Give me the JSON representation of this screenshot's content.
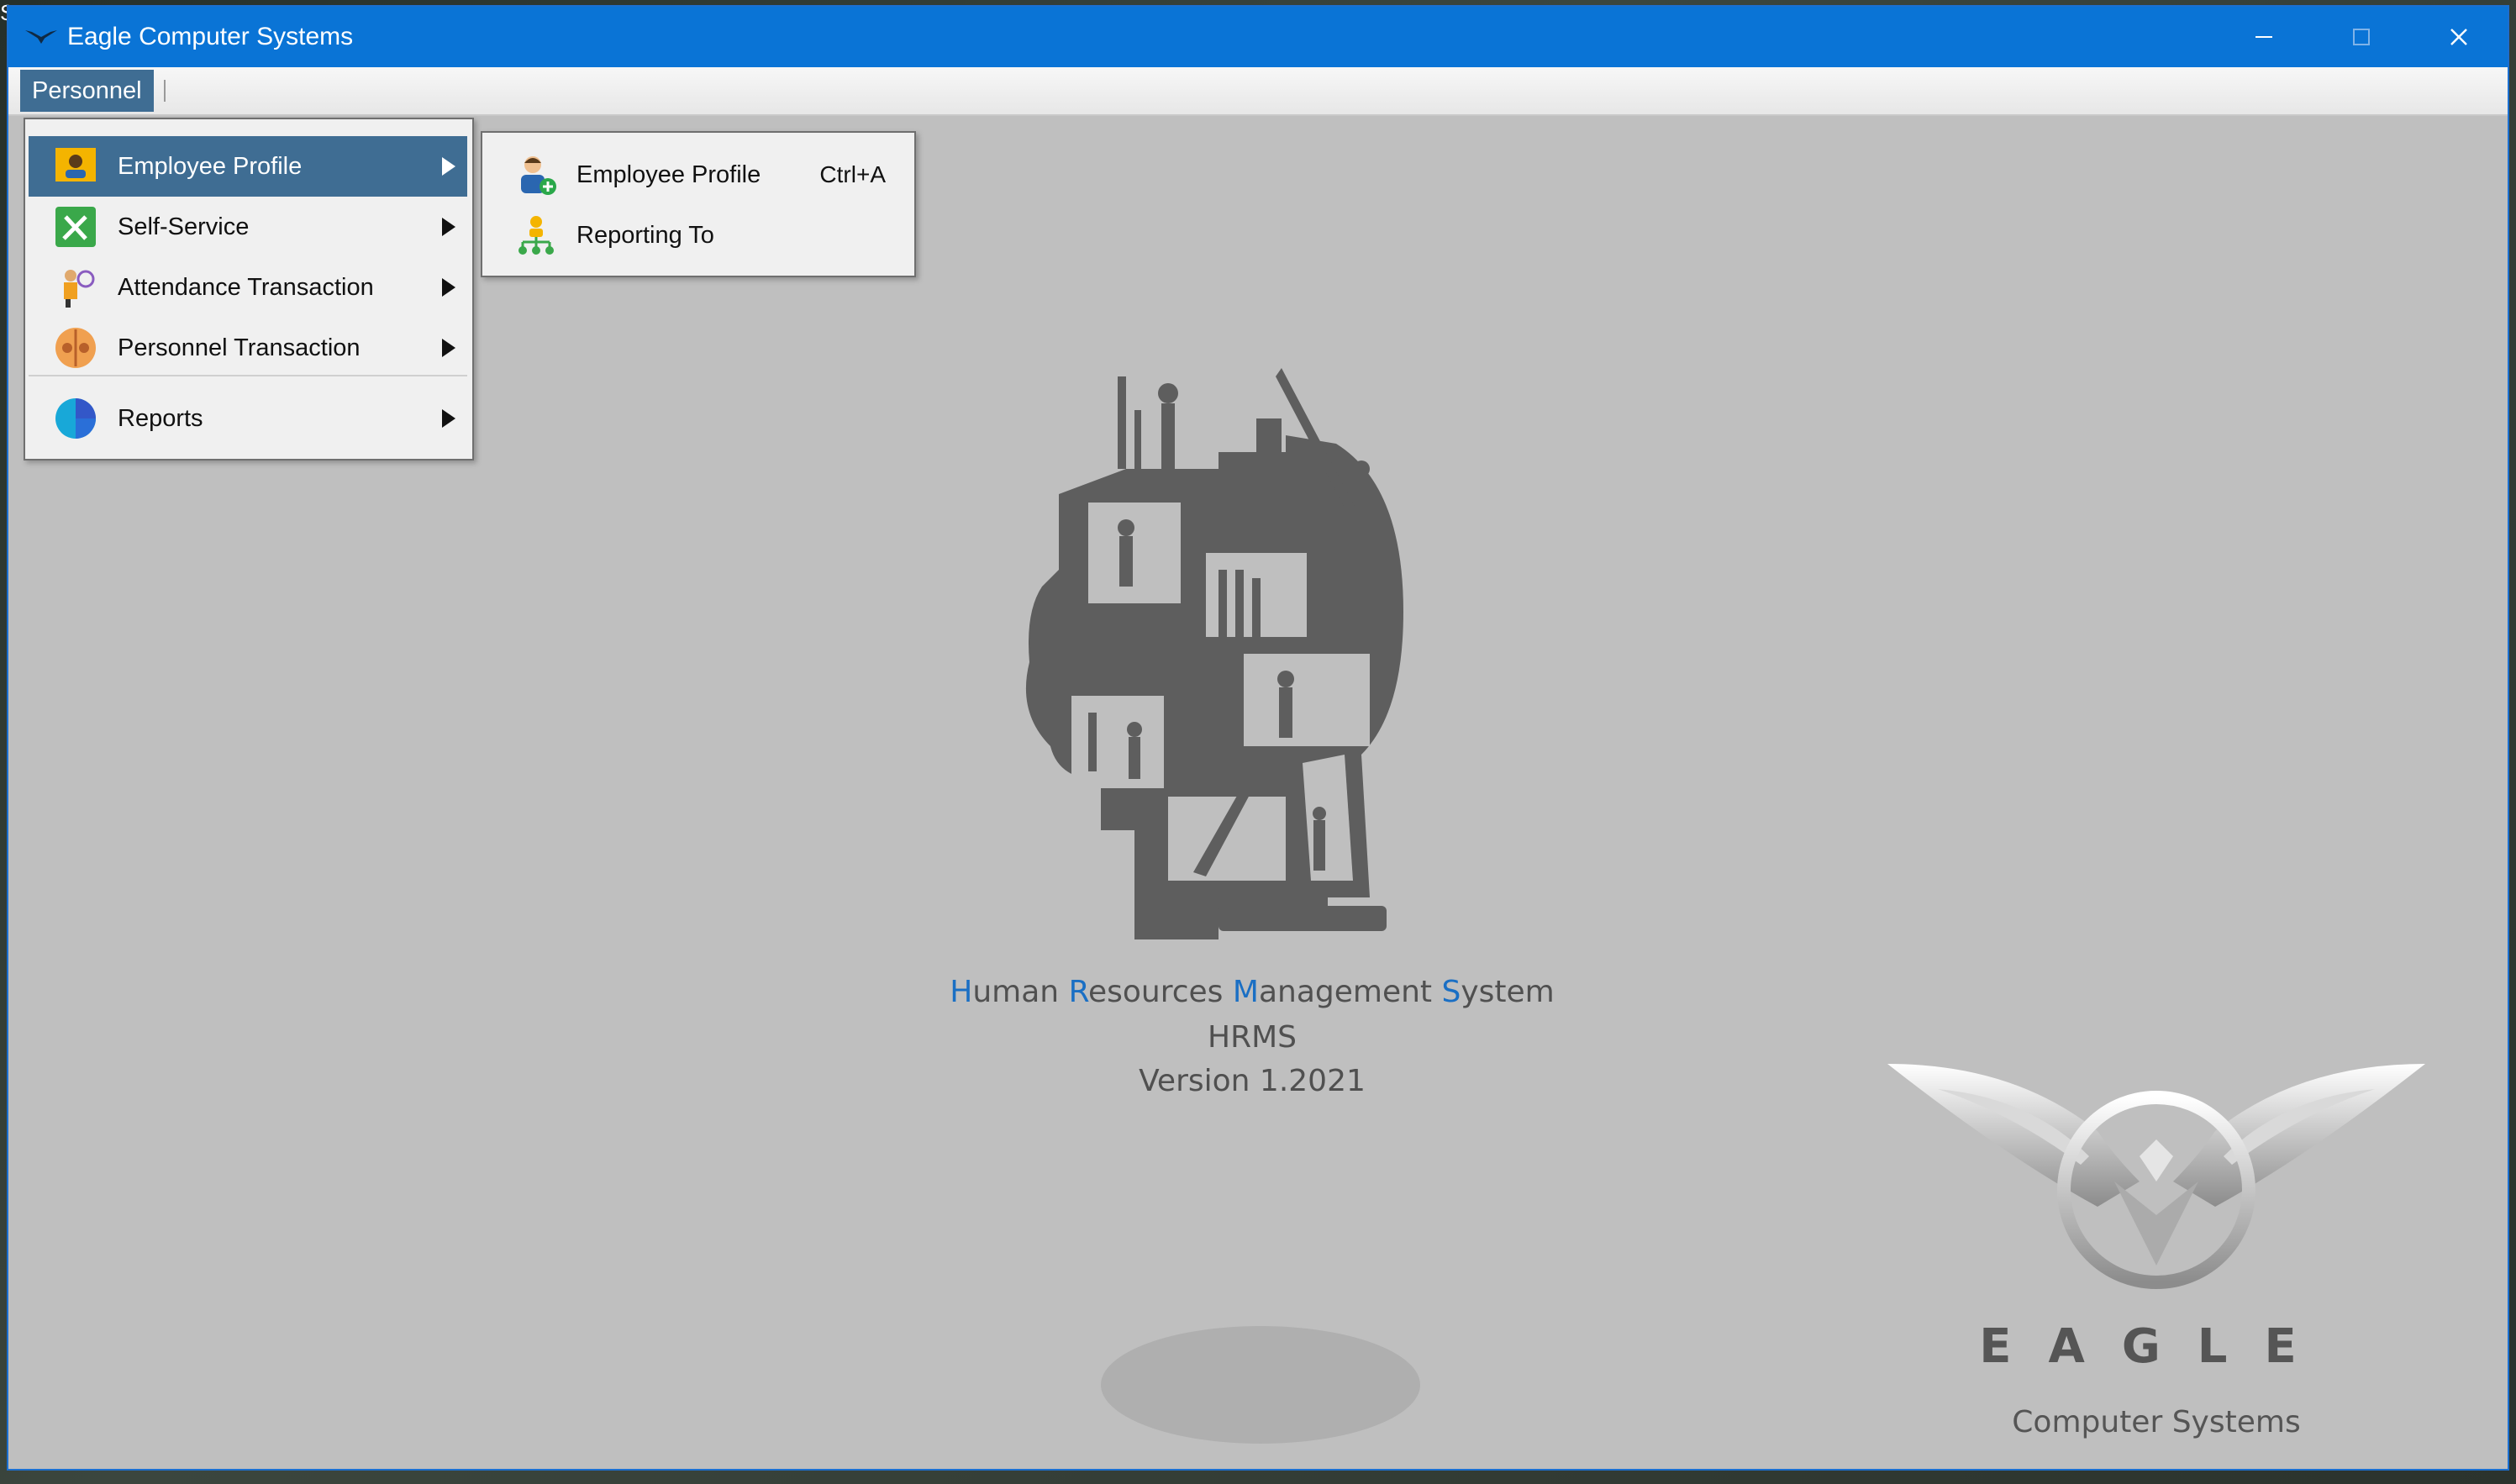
{
  "window": {
    "title": "Eagle Computer Systems",
    "controls": [
      "minimize",
      "maximize",
      "close"
    ]
  },
  "desktop": {
    "clipped_text": "S"
  },
  "menubar": {
    "personnel_label": "Personnel"
  },
  "dropdown": {
    "items": [
      {
        "label": "Employee Profile",
        "icon": "employee-profile-icon",
        "active": true
      },
      {
        "label": "Self-Service",
        "icon": "self-service-icon"
      },
      {
        "label": "Attendance Transaction",
        "icon": "attendance-icon"
      },
      {
        "label": "Personnel Transaction",
        "icon": "personnel-transaction-icon"
      },
      {
        "label": "Reports",
        "icon": "reports-pie-icon"
      }
    ]
  },
  "submenu": {
    "items": [
      {
        "label": "Employee Profile",
        "shortcut": "Ctrl+A",
        "icon": "add-employee-icon"
      },
      {
        "label": "Reporting To",
        "shortcut": "",
        "icon": "org-chart-icon"
      }
    ]
  },
  "center": {
    "title_parts": [
      {
        "cap": "H",
        "rest": "uman "
      },
      {
        "cap": "R",
        "rest": "esources "
      },
      {
        "cap": "M",
        "rest": "anagement "
      },
      {
        "cap": "S",
        "rest": "ystem"
      }
    ],
    "abbr": "HRMS",
    "version": "Version 1.2021"
  },
  "brand": {
    "letters": "EAGLE",
    "subtitle": "Computer Systems"
  },
  "colors": {
    "titlebar": "#0a74d6",
    "menu_active": "#3f6d93",
    "background": "#bfbfbf",
    "accent_caps": "#1a6fc4"
  }
}
